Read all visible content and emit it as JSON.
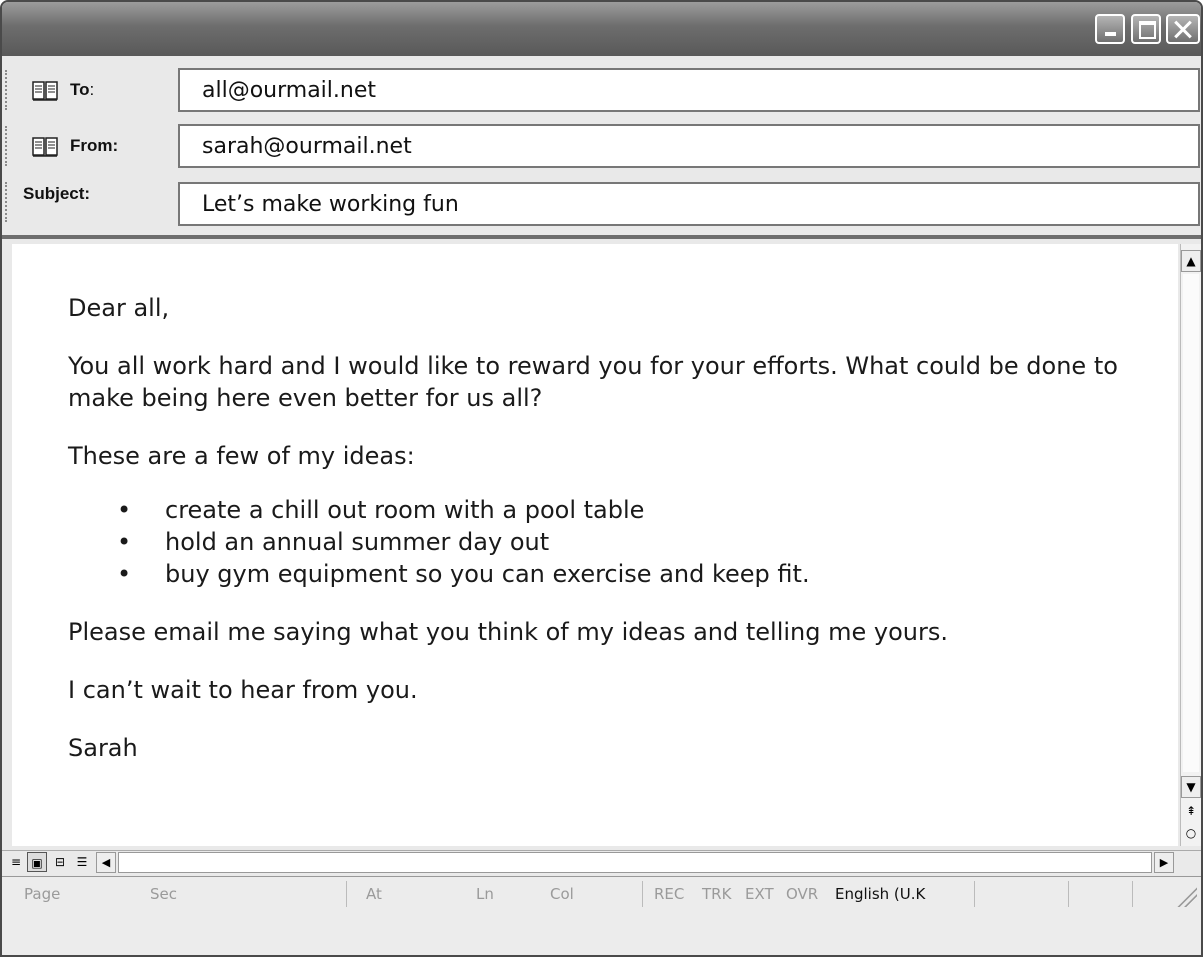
{
  "header": {
    "to_label": "To",
    "to_colon": ":",
    "to_value": "all@ourmail.net",
    "from_label": "From:",
    "from_value": "sarah@ourmail.net",
    "subject_label": "Subject:",
    "subject_value": "Let’s make working fun"
  },
  "message": {
    "greeting": "Dear all,",
    "paragraph1": "You all work hard and I would like to reward you for your efforts. What could be done to make being here even better for us all?",
    "ideas_intro": "These are a few of my ideas:",
    "ideas": [
      "create a chill out room with a pool table",
      "hold an annual summer day out",
      "buy gym equipment so you can exercise and keep fit."
    ],
    "request": "Please email me saying what you think of my ideas and telling me yours.",
    "closing": "I can’t wait to hear from you.",
    "signature": "Sarah"
  },
  "statusbar": {
    "page": "Page",
    "sec": "Sec",
    "at": "At",
    "ln": "Ln",
    "col": "Col",
    "rec": "REC",
    "trk": "TRK",
    "ext": "EXT",
    "ovr": "OVR",
    "language": "English (U.K"
  }
}
